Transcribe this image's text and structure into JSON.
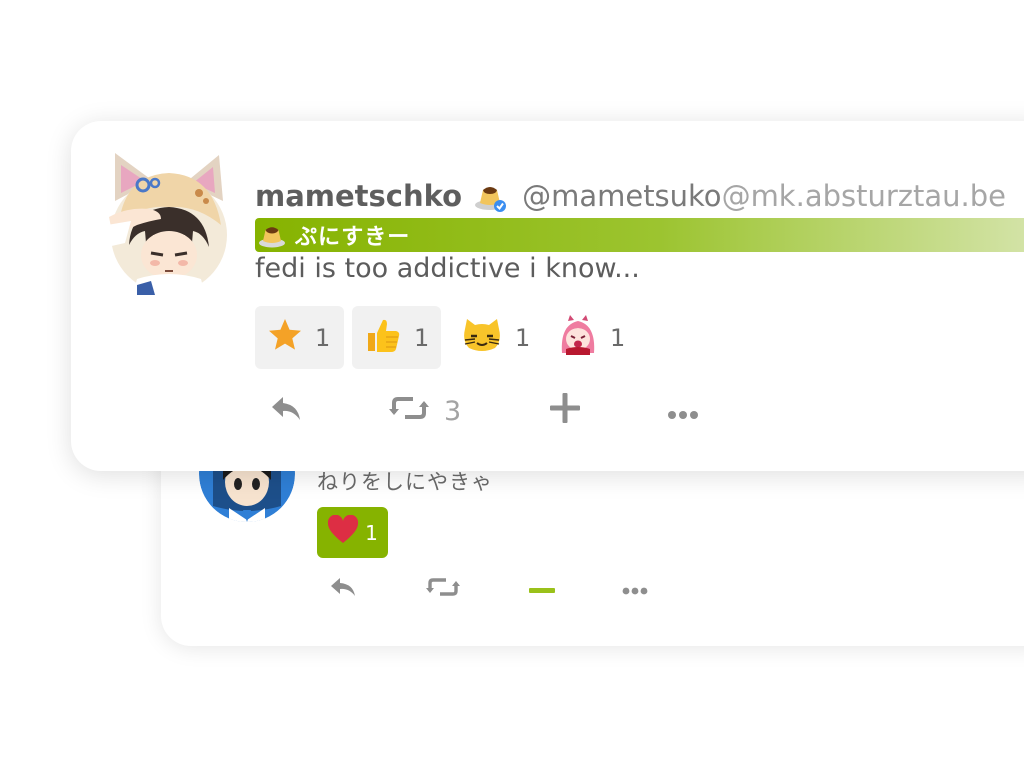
{
  "colors": {
    "accent": "#86b300",
    "card_bg": "#ffffff",
    "text": "#5c5c5c",
    "muted": "#a6a6a6"
  },
  "parent_note": {
    "text": "ねりをしにやきゃ",
    "reaction": {
      "icon": "heart-icon",
      "count": "1"
    },
    "actions": {
      "reply_icon": "reply-icon",
      "renote_icon": "repeat-icon",
      "react_icon": "minus-icon",
      "more_icon": "ellipsis-icon"
    }
  },
  "note": {
    "user": {
      "display_name": "mametschko",
      "username": "@mametsuko",
      "host": "@mk.absturztau.be"
    },
    "badge": {
      "label": "ぷにすきー",
      "icon": "pudding-icon"
    },
    "text": "fedi is too addictive i know...",
    "reactions": [
      {
        "icon": "star-icon",
        "count": "1",
        "selected": true
      },
      {
        "icon": "thumbs-up-icon",
        "count": "1",
        "selected": true
      },
      {
        "icon": "cat-face-icon",
        "count": "1",
        "selected": false
      },
      {
        "icon": "anime-girl-emoji-icon",
        "count": "1",
        "selected": false
      }
    ],
    "actions": {
      "reply_icon": "reply-icon",
      "renote_icon": "repeat-icon",
      "renote_count": "3",
      "react_icon": "plus-icon",
      "more_icon": "ellipsis-icon"
    }
  }
}
